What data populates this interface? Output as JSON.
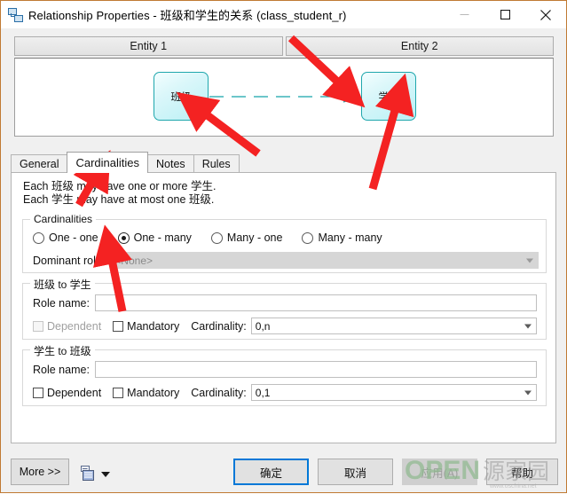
{
  "window": {
    "title": "Relationship Properties - 班级和学生的关系 (class_student_r)",
    "icon": "relationship-icon",
    "controls": {
      "minimize": "—",
      "maximize": "□",
      "close": "✕"
    },
    "border_color": "#c07a33"
  },
  "entity_header": {
    "entity1_label": "Entity 1",
    "entity2_label": "Entity 2"
  },
  "diagram": {
    "entity1_name": "班级",
    "entity2_name": "学生",
    "link_style": "dashed",
    "link_color": "#15a3aa",
    "entity_border_color": "#1fa7ad",
    "crowsfoot_side": "entity2"
  },
  "tabs": [
    {
      "label": "General",
      "active": false
    },
    {
      "label": "Cardinalities",
      "active": true
    },
    {
      "label": "Notes",
      "active": false
    },
    {
      "label": "Rules",
      "active": false
    }
  ],
  "description": {
    "line1": "Each 班级 may have one or more 学生.",
    "line2": "Each 学生 may have at most one 班级."
  },
  "cardinalities_group": {
    "legend": "Cardinalities",
    "options": [
      {
        "label": "One - one",
        "selected": false
      },
      {
        "label": "One - many",
        "selected": true
      },
      {
        "label": "Many - one",
        "selected": false
      },
      {
        "label": "Many - many",
        "selected": false
      }
    ],
    "dominant_role_label": "Dominant role:",
    "dominant_role_value": "<None>",
    "dominant_role_disabled": true
  },
  "role_group_1": {
    "legend": "班级 to 学生",
    "role_name_label": "Role name:",
    "role_name_value": "",
    "dependent_label": "Dependent",
    "dependent_checked": false,
    "dependent_disabled": true,
    "mandatory_label": "Mandatory",
    "mandatory_checked": false,
    "cardinality_label": "Cardinality:",
    "cardinality_value": "0,n"
  },
  "role_group_2": {
    "legend": "学生 to 班级",
    "role_name_label": "Role name:",
    "role_name_value": "",
    "dependent_label": "Dependent",
    "dependent_checked": false,
    "dependent_disabled": false,
    "mandatory_label": "Mandatory",
    "mandatory_checked": false,
    "cardinality_label": "Cardinality:",
    "cardinality_value": "0,1"
  },
  "footer": {
    "more_label": "More >>",
    "report_icon": "report-icon",
    "report_dropdown_icon": "chevron-down-icon",
    "ok_label": "确定",
    "cancel_label": "取消",
    "apply_label": "应用(A)",
    "apply_disabled": true,
    "help_label": "帮助",
    "default_button": "ok",
    "default_outline_color": "#0078d7"
  },
  "annotations": {
    "arrow_color": "#f42222",
    "count": 4,
    "targets": [
      "entity1-box",
      "entity2-box",
      "cardinalities-tab",
      "one-many-radio"
    ]
  },
  "watermark": {
    "text": "OPEN",
    "text2": "源代码",
    "color": "#9bbf9b"
  }
}
